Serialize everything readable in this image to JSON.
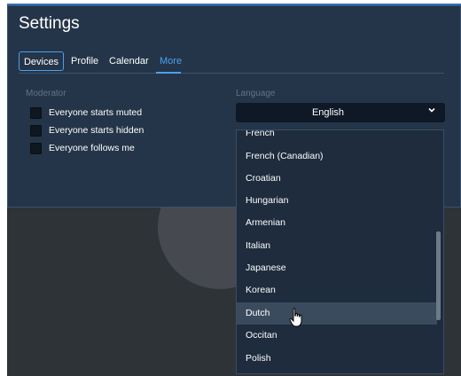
{
  "dialog": {
    "title": "Settings",
    "tabs": [
      {
        "label": "Devices"
      },
      {
        "label": "Profile"
      },
      {
        "label": "Calendar"
      },
      {
        "label": "More"
      }
    ]
  },
  "moderator": {
    "heading": "Moderator",
    "options": [
      {
        "label": "Everyone starts muted"
      },
      {
        "label": "Everyone starts hidden"
      },
      {
        "label": "Everyone follows me"
      }
    ]
  },
  "language": {
    "heading": "Language",
    "selected": "English",
    "options": [
      {
        "label": "French"
      },
      {
        "label": "French (Canadian)"
      },
      {
        "label": "Croatian"
      },
      {
        "label": "Hungarian"
      },
      {
        "label": "Armenian"
      },
      {
        "label": "Italian"
      },
      {
        "label": "Japanese"
      },
      {
        "label": "Korean"
      },
      {
        "label": "Dutch"
      },
      {
        "label": "Occitan"
      },
      {
        "label": "Polish"
      }
    ],
    "hovered": "Dutch"
  },
  "icons": {
    "chevron": "chevron-down-icon",
    "cursor": "hand-pointer-icon",
    "avatar": "avatar-placeholder-icon"
  },
  "colors": {
    "accent": "#4aa0f0",
    "dialog_bg": "#243549",
    "dropdown_bg": "#1e2c3d"
  }
}
